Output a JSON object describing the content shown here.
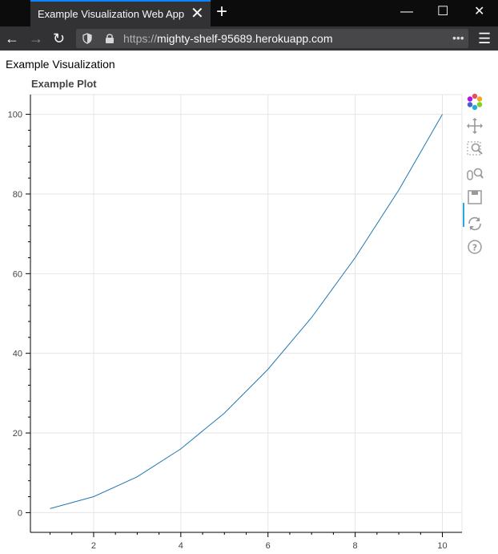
{
  "browser": {
    "tab_title": "Example Visualization Web App",
    "url_scheme": "https://",
    "url_host": "mighty-shelf-95689.herokuapp.com",
    "menu_dots": "•••"
  },
  "page": {
    "heading": "Example Visualization",
    "plot_title": "Example Plot"
  },
  "toolbar": {
    "tools": [
      "bokeh-logo-icon",
      "pan-icon",
      "box-zoom-icon",
      "wheel-zoom-icon",
      "save-icon",
      "reset-icon",
      "help-icon"
    ]
  },
  "colors": {
    "line": "#1f77b4",
    "grid": "#e5e5e5",
    "active_tool": "#26aae1"
  },
  "chart_data": {
    "type": "line",
    "title": "Example Plot",
    "xlabel": "",
    "ylabel": "",
    "x": [
      1,
      2,
      3,
      4,
      5,
      6,
      7,
      8,
      9,
      10
    ],
    "series": [
      {
        "values": [
          1,
          4,
          9,
          16,
          25,
          36,
          49,
          64,
          81,
          100
        ]
      }
    ],
    "xlim": [
      0.55,
      10.45
    ],
    "ylim": [
      -4.95,
      104.95
    ],
    "xticks": [
      2,
      4,
      6,
      8,
      10
    ],
    "yticks": [
      0,
      20,
      40,
      60,
      80,
      100
    ],
    "xtick_labels": [
      "2",
      "4",
      "6",
      "8",
      "10"
    ],
    "ytick_labels": [
      "0",
      "20",
      "40",
      "60",
      "80",
      "100"
    ],
    "grid": true,
    "legend": "none"
  }
}
